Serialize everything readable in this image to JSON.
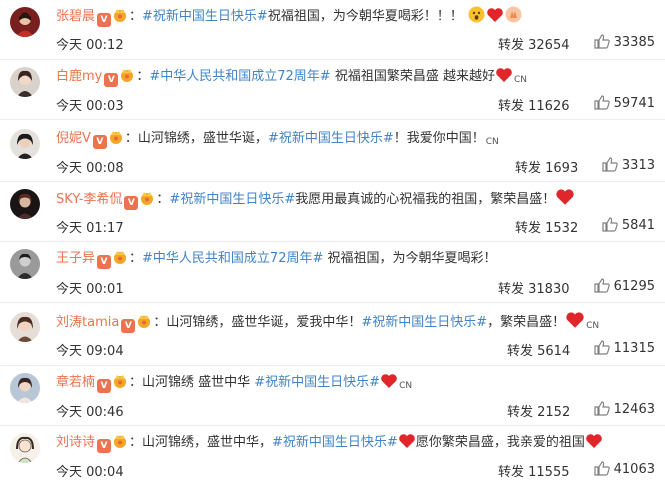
{
  "rows": [
    {
      "name": "张碧晨",
      "pre": "：",
      "topic": "#祝新中国生日快乐#",
      "text": "祝福祖国，为今朝华夏喝彩！！！",
      "post": "",
      "suffix": "",
      "time": "今天 00:12",
      "repost": "转发 32654",
      "likes": "33385"
    },
    {
      "name": "白鹿my",
      "pre": "：",
      "topic": "#中华人民共和国成立72周年#",
      "text": " 祝福祖国繁荣昌盛 越来越好",
      "post": "",
      "suffix": "CN",
      "time": "今天 00:03",
      "repost": "转发 11626",
      "likes": "59741"
    },
    {
      "name": "倪妮V",
      "pre": "：山河锦绣，盛世华诞，",
      "topic": "#祝新中国生日快乐#",
      "text": "！我爱你中国！",
      "post": "",
      "suffix": "CN",
      "time": "今天 00:08",
      "repost": "转发 1693",
      "likes": "3313"
    },
    {
      "name": "SKY-李希侃",
      "pre": "：",
      "topic": "#祝新中国生日快乐#",
      "text": "我愿用最真诚的心祝福我的祖国，繁荣昌盛！",
      "post": "",
      "suffix": "",
      "time": "今天 01:17",
      "repost": "转发 1532",
      "likes": "5841"
    },
    {
      "name": "王子异",
      "pre": "：",
      "topic": "#中华人民共和国成立72周年#",
      "text": " 祝福祖国，为今朝华夏喝彩！",
      "post": "",
      "suffix": "",
      "time": "今天 00:01",
      "repost": "转发 31830",
      "likes": "61295"
    },
    {
      "name": "刘涛tamia",
      "pre": "：山河锦绣，盛世华诞，爱我中华！",
      "topic": "#祝新中国生日快乐#",
      "text": "，繁荣昌盛！",
      "post": "",
      "suffix": "CN",
      "time": "今天 09:04",
      "repost": "转发 5614",
      "likes": "11315"
    },
    {
      "name": "章若楠",
      "pre": "：山河锦绣 盛世中华 ",
      "topic": "#祝新中国生日快乐#",
      "text": "",
      "post": "",
      "suffix": "CN",
      "time": "今天 00:46",
      "repost": "转发 2152",
      "likes": "12463"
    },
    {
      "name": "刘诗诗",
      "pre": "：山河锦绣，盛世中华，",
      "topic": "#祝新中国生日快乐#",
      "text": "愿你繁荣昌盛，我亲爱的祖国",
      "post": "",
      "suffix": "",
      "time": "今天 00:04",
      "repost": "转发 11555",
      "likes": "41063"
    }
  ],
  "colors": {
    "name": "#eb7350",
    "topic": "#4083c8",
    "heart": "#e0262b"
  },
  "icons": {
    "verified": "orange-v-badge",
    "crown": "crown-emoji",
    "heart": "red-heart",
    "like": "thumbs-up-icon"
  },
  "badge_letter": "V"
}
